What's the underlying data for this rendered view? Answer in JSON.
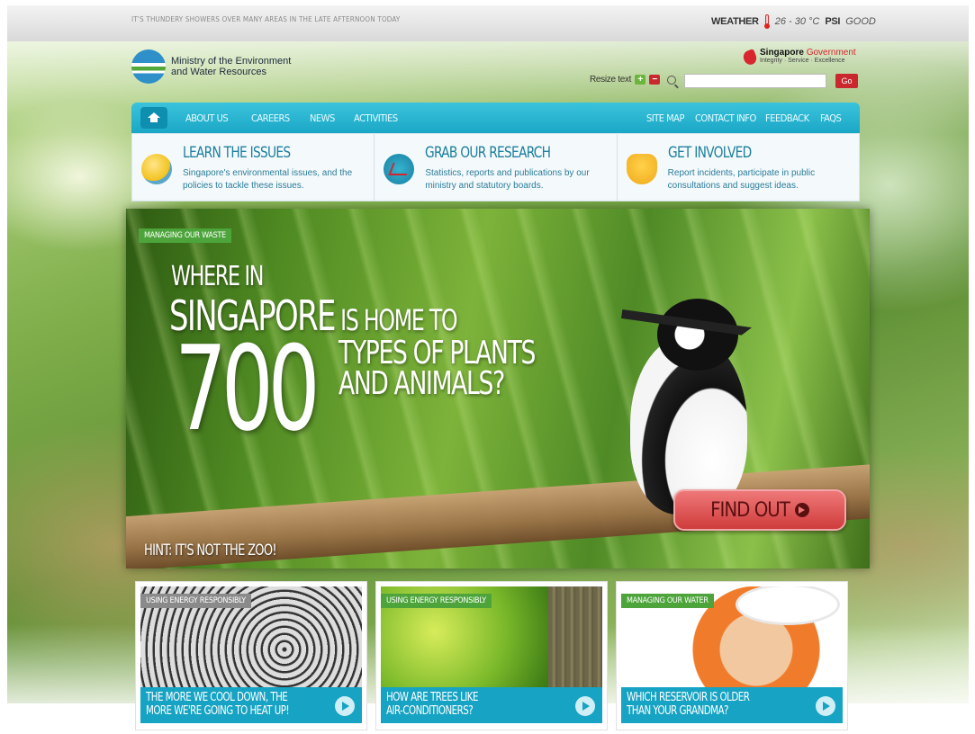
{
  "topbar": {
    "tagline": "IT'S THUNDERY SHOWERS OVER MANY AREAS IN THE LATE AFTERNOON TODAY",
    "weather_label": "WEATHER",
    "weather_value": "26 - 30 °C",
    "psi_label": "PSI",
    "psi_value": "GOOD"
  },
  "header": {
    "logo_line1": "Ministry of the Environment",
    "logo_line2": "and Water Resources",
    "gov_name_a": "Singapore",
    "gov_name_b": "Government",
    "gov_motto": "Integrity · Service · Excellence",
    "resize_label": "Resize text",
    "resize_plus": "+",
    "resize_minus": "−",
    "search_placeholder": "",
    "go_label": "Go"
  },
  "nav": {
    "left": [
      "ABOUT US",
      "CAREERS",
      "NEWS",
      "ACTIVITIES"
    ],
    "right": [
      "SITE MAP",
      "CONTACT INFO",
      "FEEDBACK",
      "FAQS"
    ]
  },
  "features": [
    {
      "title": "LEARN THE ISSUES",
      "desc": "Singapore's environmental issues, and the policies to tackle these issues."
    },
    {
      "title": "GRAB OUR RESEARCH",
      "desc": "Statistics, reports and publications by our ministry and statutory boards."
    },
    {
      "title": "GET INVOLVED",
      "desc": "Report incidents, participate in public consultations and suggest ideas."
    }
  ],
  "hero": {
    "badge": "MANAGING OUR WASTE",
    "line1": "WHERE IN",
    "line2_big": "SINGAPORE",
    "line2_small": " IS HOME TO",
    "number": "700",
    "types_line1": "TYPES OF PLANTS",
    "types_line2": "AND ANIMALS?",
    "hint": "HINT: IT'S NOT THE ZOO!",
    "cta": "FIND OUT"
  },
  "cards": [
    {
      "badge": "USING ENERGY RESPONSIBLY",
      "line1": "THE MORE WE COOL DOWN, THE",
      "line2": "MORE WE'RE GOING TO HEAT UP!"
    },
    {
      "badge": "USING ENERGY RESPONSIBLY",
      "line1": "HOW ARE TREES LIKE",
      "line2": "AIR-CONDITIONERS?"
    },
    {
      "badge": "MANAGING OUR WATER",
      "line1": "WHICH RESERVOIR IS OLDER",
      "line2": "THAN YOUR GRANDMA?"
    }
  ]
}
